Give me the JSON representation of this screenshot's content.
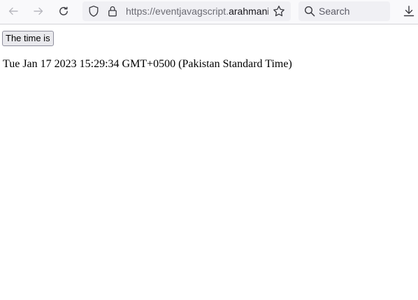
{
  "browser": {
    "url_scheme": "https://",
    "url_subdomain": "eventjavagscript.",
    "url_host": "arahmani",
    "search_placeholder": "Search",
    "icons": {
      "back": "arrow-left-icon",
      "forward": "arrow-right-icon",
      "reload": "reload-icon",
      "tracking_protection": "shield-icon",
      "secure": "lock-icon",
      "bookmark": "star-icon",
      "search": "search-icon",
      "downloads": "download-icon"
    }
  },
  "page": {
    "button_label": "The time is",
    "time_text": "Tue Jan 17 2023 15:29:34 GMT+0500 (Pakistan Standard Time)"
  }
}
